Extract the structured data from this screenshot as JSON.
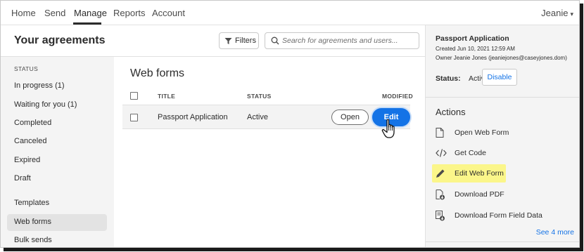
{
  "nav": {
    "items": [
      "Home",
      "Send",
      "Manage",
      "Reports",
      "Account"
    ],
    "active": "Manage",
    "user": "Jeanie",
    "user_caret": "▾"
  },
  "header": {
    "title": "Your agreements",
    "filters_label": "Filters",
    "search_placeholder": "Search for agreements and users..."
  },
  "sidebar": {
    "status_heading": "STATUS",
    "status_items": [
      "In progress (1)",
      "Waiting for you (1)",
      "Completed",
      "Canceled",
      "Expired",
      "Draft"
    ],
    "other_items": [
      "Templates",
      "Web forms",
      "Bulk sends"
    ],
    "selected": "Web forms"
  },
  "main": {
    "title": "Web forms",
    "columns": {
      "title": "TITLE",
      "status": "STATUS",
      "modified": "MODIFIED"
    },
    "rows": [
      {
        "title": "Passport Application",
        "status": "Active",
        "open_label": "Open",
        "edit_label": "Edit"
      }
    ]
  },
  "details": {
    "title": "Passport Application",
    "created": "Created Jun 10, 2021 12:59 AM",
    "owner": "Owner Jeanie Jones (jeaniejones@caseyjones.dom)",
    "status_label": "Status:",
    "status_value": "Active",
    "disable_label": "Disable",
    "actions_heading": "Actions",
    "actions": [
      {
        "label": "Open Web Form",
        "icon": "document-icon"
      },
      {
        "label": "Get Code",
        "icon": "code-icon"
      },
      {
        "label": "Edit Web Form",
        "icon": "pencil-icon",
        "highlight_color": "#fbf68a"
      },
      {
        "label": "Download PDF",
        "icon": "download-pdf-icon"
      },
      {
        "label": "Download Form Field Data",
        "icon": "download-data-icon"
      }
    ],
    "see_more": "See 4 more"
  },
  "colors": {
    "accent": "#1473e6",
    "highlight": "#fbf68a"
  }
}
